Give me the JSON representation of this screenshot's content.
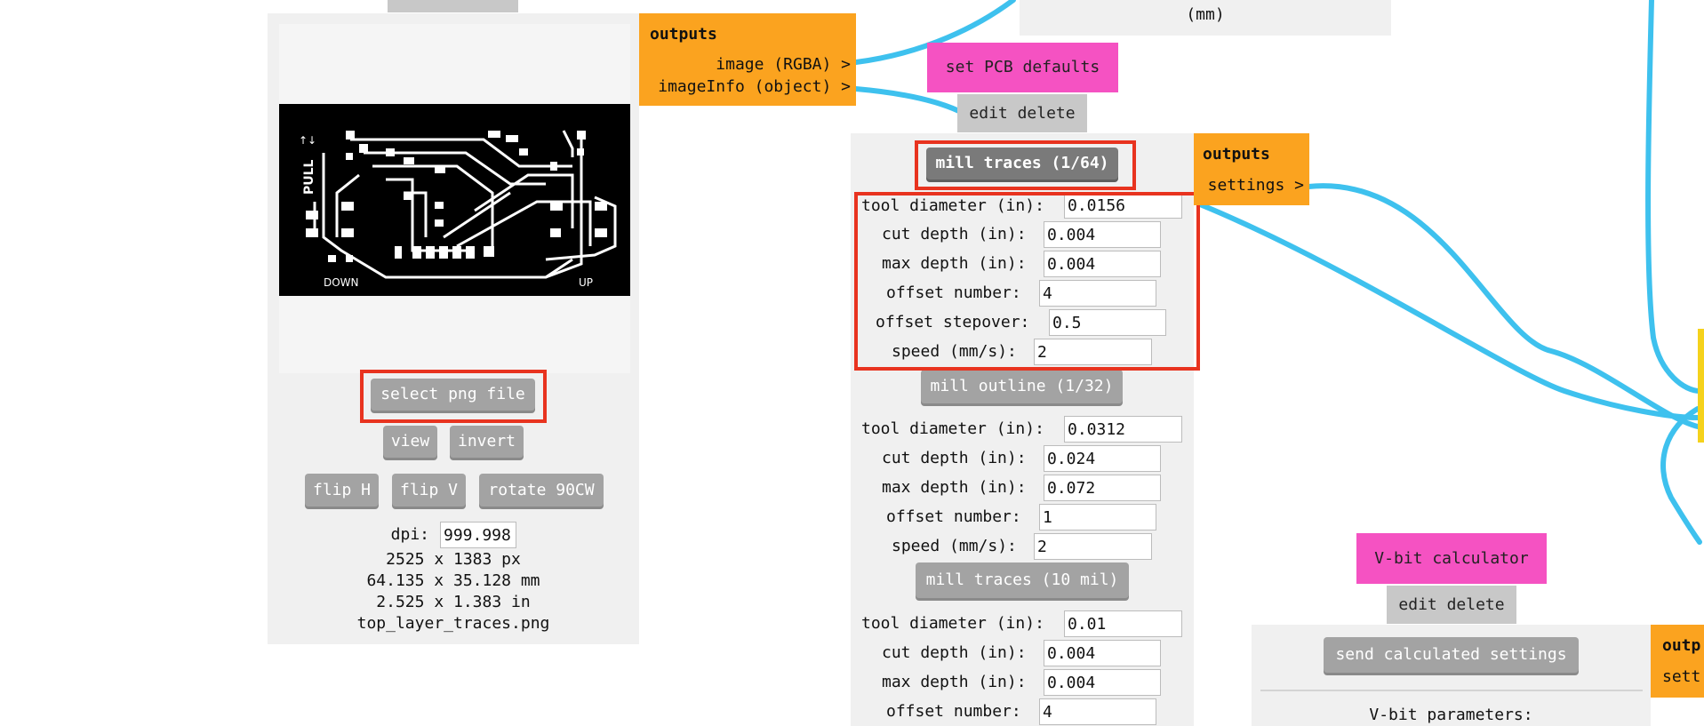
{
  "colors": {
    "wire": "#3ec1ee",
    "outputs": "#fba31f",
    "module_pink": "#f552c2",
    "highlight": "#e8331f",
    "panel": "#f0f0f0",
    "button": "#a3a3a3"
  },
  "top_right_panel": {
    "partial_text": "(mm)"
  },
  "image_panel": {
    "pcb_labels": {
      "pull": "PULL",
      "pull_arrow": "↑↓",
      "down": "DOWN",
      "up": "UP"
    },
    "select_button": "select png file",
    "view_button": "view",
    "invert_button": "invert",
    "flip_h_button": "flip H",
    "flip_v_button": "flip V",
    "rotate_button": "rotate 90CW",
    "dpi_label": "dpi:",
    "dpi_value": "999.998",
    "size_px": "2525 x 1383 px",
    "size_mm": "64.135 x 35.128 mm",
    "size_in": "2.525 x 1.383 in",
    "filename": "top_layer_traces.png"
  },
  "image_outputs": {
    "title": "outputs",
    "port1": "image (RGBA) >",
    "port2": "imageInfo (object) >"
  },
  "pcb_defaults": {
    "title": "set PCB defaults",
    "edit_delete": "edit delete",
    "mill_traces_164": {
      "button": "mill traces (1/64)",
      "tool_diameter_label": "tool diameter (in):",
      "tool_diameter": "0.0156",
      "cut_depth_label": "cut depth (in):",
      "cut_depth": "0.004",
      "max_depth_label": "max depth (in):",
      "max_depth": "0.004",
      "offset_number_label": "offset number:",
      "offset_number": "4",
      "offset_stepover_label": "offset stepover:",
      "offset_stepover": "0.5",
      "speed_label": "speed (mm/s):",
      "speed": "2"
    },
    "mill_outline_132": {
      "button": "mill outline (1/32)",
      "tool_diameter_label": "tool diameter (in):",
      "tool_diameter": "0.0312",
      "cut_depth_label": "cut depth (in):",
      "cut_depth": "0.024",
      "max_depth_label": "max depth (in):",
      "max_depth": "0.072",
      "offset_number_label": "offset number:",
      "offset_number": "1",
      "speed_label": "speed (mm/s):",
      "speed": "2"
    },
    "mill_traces_10mil": {
      "button": "mill traces (10 mil)",
      "tool_diameter_label": "tool diameter (in):",
      "tool_diameter": "0.01",
      "cut_depth_label": "cut depth (in):",
      "cut_depth": "0.004",
      "max_depth_label": "max depth (in):",
      "max_depth": "0.004",
      "offset_number_label": "offset number:",
      "offset_number": "4"
    }
  },
  "pcb_outputs": {
    "title": "outputs",
    "port": "settings >"
  },
  "vbit": {
    "title": "V-bit calculator",
    "edit_delete": "edit delete",
    "send_button": "send calculated settings",
    "params_label": "V-bit parameters:"
  },
  "vbit_outputs": {
    "title": "outp",
    "port": "sett"
  }
}
